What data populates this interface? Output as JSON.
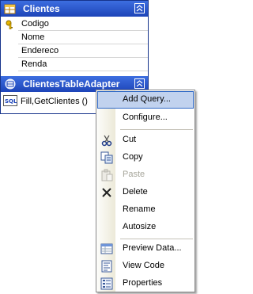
{
  "table": {
    "title": "Clientes",
    "columns": [
      "Codigo",
      "Nome",
      "Endereco",
      "Renda"
    ],
    "primary_key_icon": "key-icon"
  },
  "adapter": {
    "title": "ClientesTableAdapter",
    "query": "Fill,GetClientes ()",
    "query_icon": "sql-icon"
  },
  "menu": {
    "items": [
      {
        "label": "Add Query...",
        "icon": "",
        "highlighted": true
      },
      {
        "label": "Configure...",
        "icon": ""
      },
      {
        "label": "Cut",
        "icon": "scissors-icon"
      },
      {
        "label": "Copy",
        "icon": "copy-icon"
      },
      {
        "label": "Paste",
        "icon": "paste-icon",
        "disabled": true
      },
      {
        "label": "Delete",
        "icon": "delete-x-icon"
      },
      {
        "label": "Rename",
        "icon": ""
      },
      {
        "label": "Autosize",
        "icon": ""
      },
      {
        "label": "Preview Data...",
        "icon": "preview-data-icon"
      },
      {
        "label": "View Code",
        "icon": "view-code-icon"
      },
      {
        "label": "Properties",
        "icon": "properties-icon"
      }
    ]
  },
  "colors": {
    "header_blue": "#2a55c8",
    "highlight_fill": "#c1d2ee",
    "highlight_border": "#316ac5"
  }
}
